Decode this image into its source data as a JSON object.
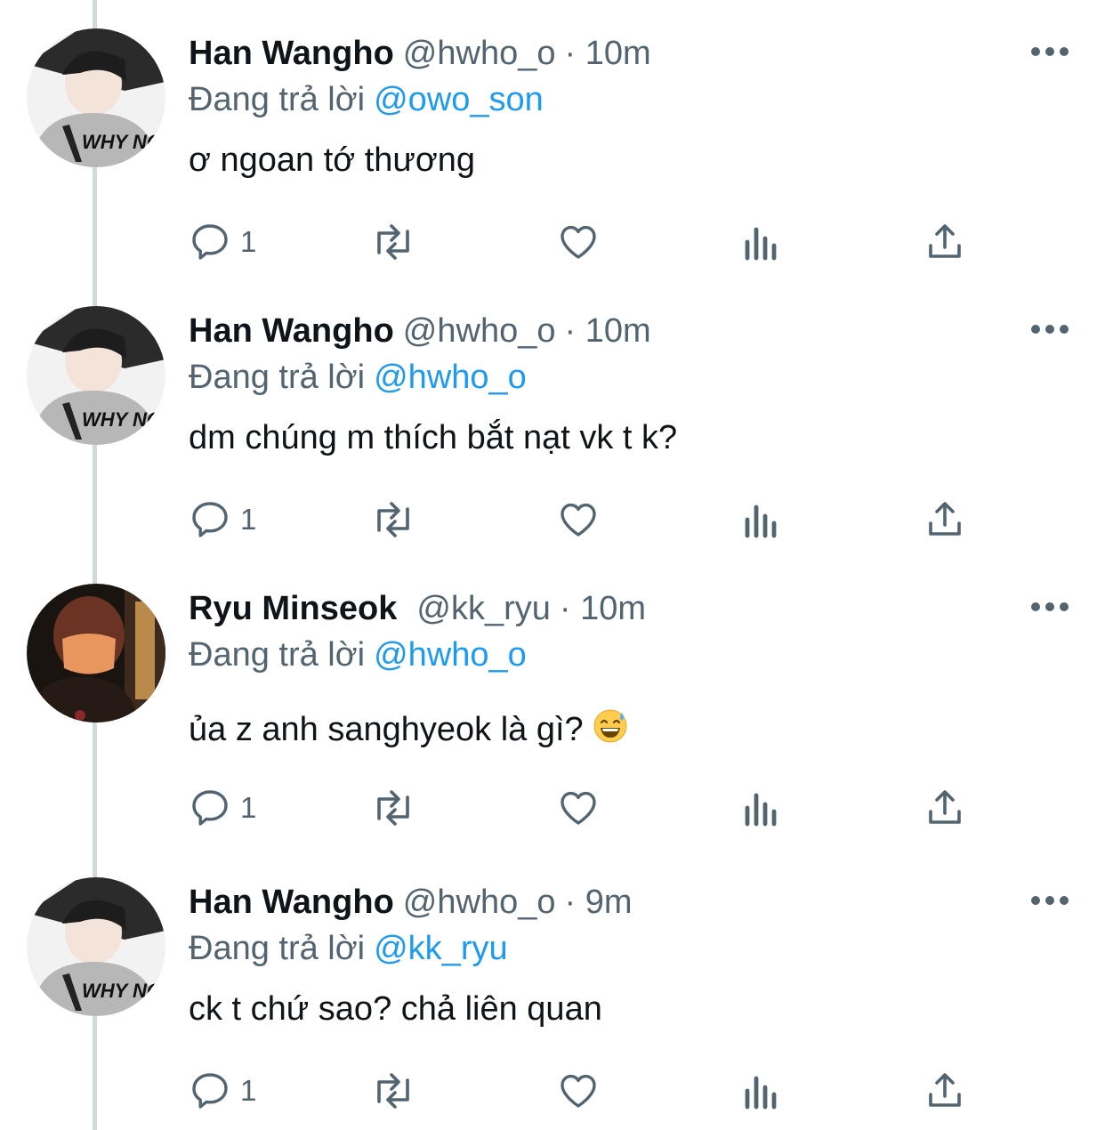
{
  "tweets": [
    {
      "name": "Han Wangho",
      "handle": "@hwho_o",
      "time": "· 10m",
      "replying_label": "Đang trả lời",
      "replying_to": "@owo_son",
      "text": "ơ ngoan tớ thương",
      "reply_count": "1",
      "avatar": "avatar-hanwangho"
    },
    {
      "name": "Han Wangho",
      "handle": "@hwho_o",
      "time": "· 10m",
      "replying_label": "Đang trả lời",
      "replying_to": "@hwho_o",
      "text": "dm chúng m thích bắt nạt vk t k?",
      "reply_count": "1",
      "avatar": "avatar-hanwangho"
    },
    {
      "name": "Ryu Minseok",
      "handle": "@kk_ryu",
      "time": "· 10m",
      "replying_label": "Đang trả lời",
      "replying_to": "@hwho_o",
      "text": "ủa z anh sanghyeok là gì?",
      "reply_count": "1",
      "avatar": "avatar-ryuminseok",
      "emoji": "grinning-sweat-emoji"
    },
    {
      "name": "Han Wangho",
      "handle": "@hwho_o",
      "time": "· 9m",
      "replying_label": "Đang trả lời",
      "replying_to": "@kk_ryu",
      "text": "ck t chứ sao? chả liên quan",
      "reply_count": "1",
      "avatar": "avatar-hanwangho"
    }
  ],
  "icons": {
    "reply": "reply-icon",
    "retweet": "retweet-icon",
    "like": "heart-icon",
    "analytics": "analytics-icon",
    "share": "share-icon",
    "more": "more-icon"
  },
  "colors": {
    "name": "#0f1419",
    "secondary": "#536471",
    "link": "#1d9bf0",
    "thread_line": "#cfd9de"
  }
}
